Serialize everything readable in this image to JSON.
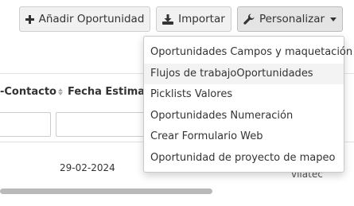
{
  "toolbar": {
    "add_label": "Añadir Oportunidad",
    "import_label": "Importar",
    "customize_label": "Personalizar"
  },
  "table": {
    "col_contact": "-Contacto",
    "col_date": "Fecha Estimada",
    "row_date": "29-02-2024",
    "row_trunc": "vilatec"
  },
  "menu": {
    "items": [
      "Oportunidades Campos y maquetación",
      "Flujos de trabajoOportunidades",
      "Picklists Valores",
      "Oportunidades Numeración",
      "Crear Formulario Web",
      "Oportunidad de proyecto de mapeo"
    ]
  },
  "colors": {
    "button_bg": "#f1f1f1",
    "active_button_bg": "#e4e4e4",
    "scrollbar": "#b9b9b9"
  }
}
